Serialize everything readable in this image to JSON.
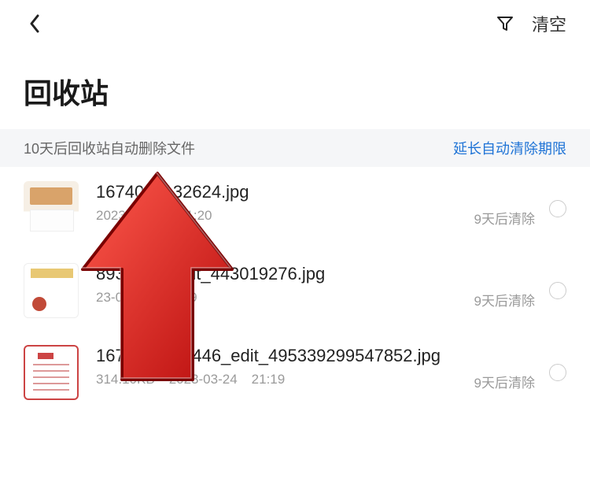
{
  "header": {
    "clear_label": "清空"
  },
  "title": "回收站",
  "notice": {
    "text": "10天后回收站自动删除文件",
    "link": "延长自动清除期限"
  },
  "files": [
    {
      "name": "1674087132624.jpg",
      "size": "",
      "date": "2023-03-24",
      "time": "21:20",
      "expire": "9天后清除"
    },
    {
      "name": "8930259_edit_443019276.jpg",
      "size": "",
      "date": "23-03-24",
      "time": "21:19",
      "expire": "9天后清除"
    },
    {
      "name": "1674958944446_edit_495339299547852.jpg",
      "size": "314.10KB",
      "date": "2023-03-24",
      "time": "21:19",
      "expire": "9天后清除"
    }
  ]
}
